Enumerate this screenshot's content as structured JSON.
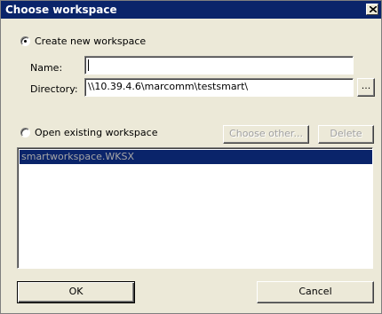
{
  "window": {
    "title": "Choose workspace",
    "close_glyph": "close-icon"
  },
  "create_section": {
    "radio_label": "Create new workspace",
    "selected": true,
    "name_label": "Name:",
    "name_value": "",
    "directory_label": "Directory:",
    "directory_value": "\\\\10.39.4.6\\marcomm\\testsmart\\",
    "browse_label": "..."
  },
  "open_section": {
    "radio_label": "Open existing workspace",
    "selected": false,
    "choose_other_label": "Choose other...",
    "delete_label": "Delete",
    "workspaces": [
      {
        "name": "smartworkspace.WKSX",
        "selected": true
      }
    ]
  },
  "footer": {
    "ok_label": "OK",
    "cancel_label": "Cancel"
  },
  "colors": {
    "titlebar": "#0a246a",
    "dialog_bg": "#ece9d8",
    "selection_bg": "#0a246a",
    "disabled_text": "#a0a0a0"
  }
}
